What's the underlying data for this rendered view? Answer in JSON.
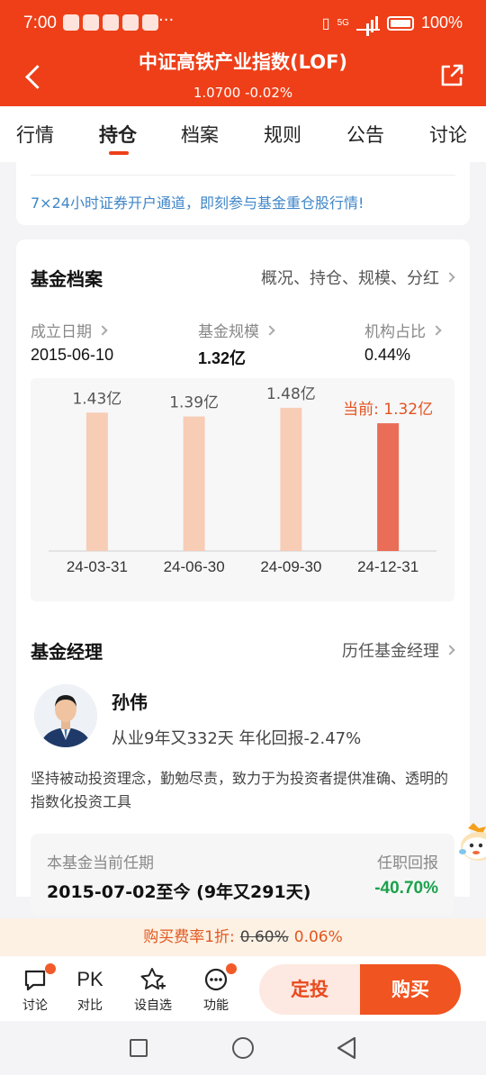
{
  "status": {
    "time": "7:00",
    "more": "···",
    "network": "5G",
    "battery": "100%"
  },
  "header": {
    "title": "中证高铁产业指数(LOF)",
    "subtitle": "1.0700 -0.02%"
  },
  "tabs": [
    {
      "label": "行情"
    },
    {
      "label": "持仓"
    },
    {
      "label": "档案"
    },
    {
      "label": "规则"
    },
    {
      "label": "公告"
    },
    {
      "label": "讨论"
    }
  ],
  "banner": {
    "text": "7×24小时证券开户通道，即刻参与基金重仓股行情!"
  },
  "archive": {
    "title": "基金档案",
    "link": "概况、持仓、规模、分红",
    "stats": [
      {
        "label": "成立日期",
        "value": "2015-06-10"
      },
      {
        "label": "基金规模",
        "value": "1.32亿"
      },
      {
        "label": "机构占比",
        "value": "0.44%"
      }
    ]
  },
  "chart_data": {
    "type": "bar",
    "categories": [
      "24-03-31",
      "24-06-30",
      "24-09-30",
      "24-12-31"
    ],
    "values": [
      1.43,
      1.39,
      1.48,
      1.32
    ],
    "value_labels": [
      "1.43亿",
      "1.39亿",
      "1.48亿",
      "当前: 1.32亿"
    ],
    "unit": "亿",
    "ylim": [
      0,
      1.6
    ],
    "colors": {
      "past": "#f7cdb6",
      "current": "#ea6d57",
      "current_label": "#e2521f",
      "label": "#555555"
    }
  },
  "manager": {
    "title": "基金经理",
    "link": "历任基金经理",
    "name": "孙伟",
    "meta": "从业9年又332天 年化回报-2.47%",
    "desc": "坚持被动投资理念，勤勉尽责，致力于为投资者提供准确、透明的指数化投资工具",
    "tenure_label": "本基金当前任期",
    "tenure_value": "2015-07-02至今 (9年又291天)",
    "return_label": "任职回报",
    "return_value": "-40.70%"
  },
  "fee": {
    "prefix": "购买费率1折:",
    "old": "0.60%",
    "new": "0.06%"
  },
  "bottom": {
    "items": [
      {
        "label": "讨论",
        "icon": "chat-icon"
      },
      {
        "label": "对比",
        "icon": "pk-icon",
        "glyph": "PK"
      },
      {
        "label": "设自选",
        "icon": "star-plus-icon"
      },
      {
        "label": "功能",
        "icon": "more-icon"
      }
    ],
    "dingtou": "定投",
    "buy": "购买"
  },
  "colors": {
    "brand": "#ee3f18",
    "link_blue": "#3f86c8",
    "green": "#1aa24a"
  }
}
